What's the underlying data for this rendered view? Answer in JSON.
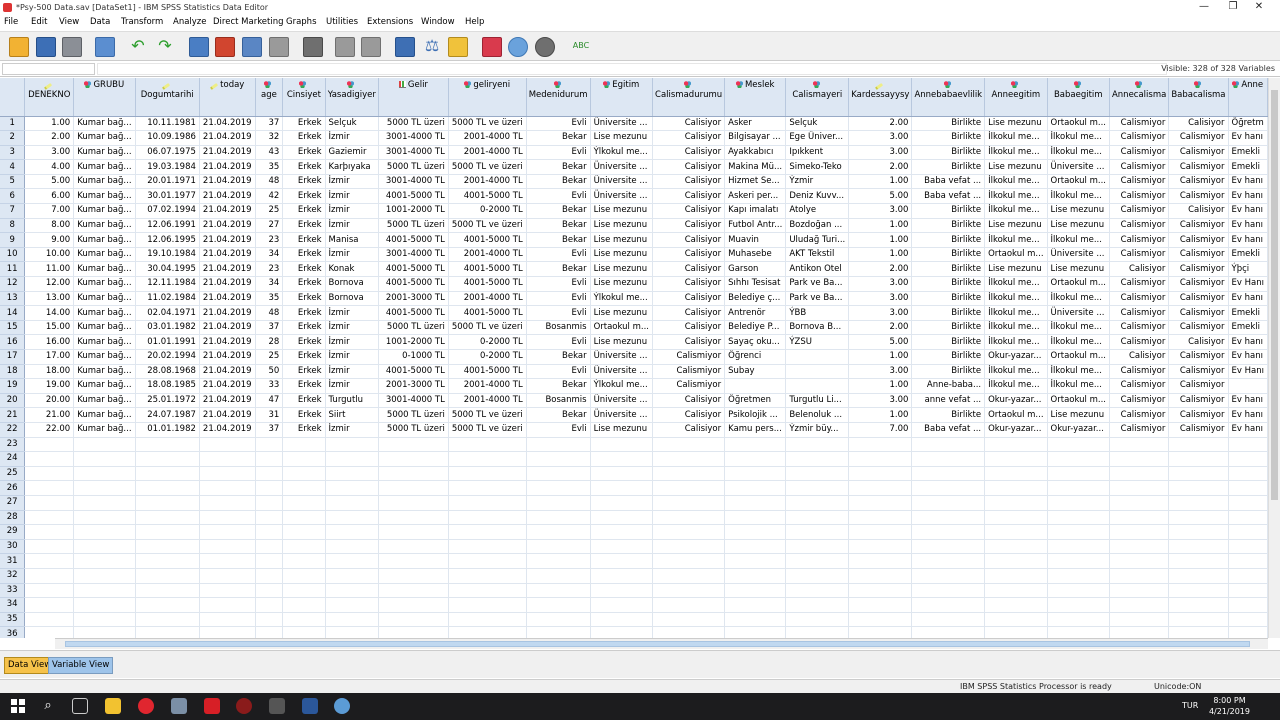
{
  "window": {
    "title": "*Psy-500 Data.sav [DataSet1] - IBM SPSS Statistics Data Editor",
    "minimize": "—",
    "restore": "❐",
    "close": "✕"
  },
  "menu": [
    "File",
    "Edit",
    "View",
    "Data",
    "Transform",
    "Analyze",
    "Direct Marketing",
    "Graphs",
    "Utilities",
    "Extensions",
    "Window",
    "Help"
  ],
  "toolbar_icons": [
    "open-folder-icon",
    "save-icon",
    "print-icon",
    "dialog-recall-icon",
    "undo-icon",
    "redo-icon",
    "goto-case-icon",
    "goto-variable-icon",
    "variables-icon",
    "find-icon",
    "insert-cases-icon",
    "insert-variable-icon",
    "split-file-icon",
    "weight-cases-icon",
    "select-cases-icon",
    "value-labels-icon",
    "use-sets-icon",
    "show-all-icon",
    "spelling-icon"
  ],
  "info": {
    "visible": "Visible: 328 of 328 Variables"
  },
  "grid": {
    "columns": [
      {
        "label": "DENEKNO",
        "type": "scale"
      },
      {
        "label": "GRUBU",
        "type": "nominal"
      },
      {
        "label": "Dogumtarihi",
        "type": "scale"
      },
      {
        "label": "today",
        "type": "scale"
      },
      {
        "label": "age",
        "type": "nominal"
      },
      {
        "label": "Cinsiyet",
        "type": "nominal"
      },
      {
        "label": "Yasadigiyer",
        "type": "nominal"
      },
      {
        "label": "Gelir",
        "type": "ordinal"
      },
      {
        "label": "geliryeni",
        "type": "nominal"
      },
      {
        "label": "Medenidurum",
        "type": "nominal"
      },
      {
        "label": "Egitim",
        "type": "nominal"
      },
      {
        "label": "Calismadurumu",
        "type": "nominal"
      },
      {
        "label": "Meslek",
        "type": "nominal"
      },
      {
        "label": "Calismayeri",
        "type": "nominal"
      },
      {
        "label": "Kardessayysy",
        "type": "scale"
      },
      {
        "label": "Annebabaevlilik",
        "type": "nominal"
      },
      {
        "label": "Anneegitim",
        "type": "nominal"
      },
      {
        "label": "Babaegitim",
        "type": "nominal"
      },
      {
        "label": "Annecalisma",
        "type": "nominal"
      },
      {
        "label": "Babacalisma",
        "type": "nominal"
      },
      {
        "label": "Anne",
        "type": "nominal"
      }
    ],
    "rows": [
      [
        "1.00",
        "Kumar bağ...",
        "10.11.1981",
        "21.04.2019",
        "37",
        "Erkek",
        "Selçuk",
        "5000 TL üzeri",
        "5000 TL ve üzeri",
        "Evli",
        "Üniversite ...",
        "Calisiyor",
        "Asker",
        "Selçuk",
        "2.00",
        "Birlikte",
        "Lise mezunu",
        "Ortaokul m...",
        "Calismiyor",
        "Calisiyor",
        "Öğretm"
      ],
      [
        "2.00",
        "Kumar bağ...",
        "10.09.1986",
        "21.04.2019",
        "32",
        "Erkek",
        "İzmir",
        "3001-4000 TL",
        "2001-4000 TL",
        "Bekar",
        "Lise mezunu",
        "Calisiyor",
        "Bilgisayar ...",
        "Ege Üniver...",
        "3.00",
        "Birlikte",
        "İlkokul me...",
        "İlkokul me...",
        "Calismiyor",
        "Calismiyor",
        "Ev hanı"
      ],
      [
        "3.00",
        "Kumar bağ...",
        "06.07.1975",
        "21.04.2019",
        "43",
        "Erkek",
        "Gaziemir",
        "3001-4000 TL",
        "2001-4000 TL",
        "Evli",
        "Ýlkokul me...",
        "Calisiyor",
        "Ayakkabıcı",
        "Ipıkkent",
        "3.00",
        "Birlikte",
        "İlkokul me...",
        "İlkokul me...",
        "Calismiyor",
        "Calismiyor",
        "Emekli"
      ],
      [
        "4.00",
        "Kumar bağ...",
        "19.03.1984",
        "21.04.2019",
        "35",
        "Erkek",
        "Karþıyaka",
        "5000 TL üzeri",
        "5000 TL ve üzeri",
        "Bekar",
        "Üniversite ...",
        "Calisiyor",
        "Makina Mü...",
        "Simeko-Teko",
        "2.00",
        "Birlikte",
        "Lise mezunu",
        "Üniversite ...",
        "Calismiyor",
        "Calismiyor",
        "Emekli"
      ],
      [
        "5.00",
        "Kumar bağ...",
        "20.01.1971",
        "21.04.2019",
        "48",
        "Erkek",
        "İzmir",
        "3001-4000 TL",
        "2001-4000 TL",
        "Bekar",
        "Üniversite ...",
        "Calisiyor",
        "Hizmet Se...",
        "Ýzmir",
        "1.00",
        "Baba vefat ...",
        "İlkokul me...",
        "Ortaokul m...",
        "Calismiyor",
        "Calismiyor",
        "Ev hanı"
      ],
      [
        "6.00",
        "Kumar bağ...",
        "30.01.1977",
        "21.04.2019",
        "42",
        "Erkek",
        "İzmir",
        "4001-5000 TL",
        "4001-5000 TL",
        "Evli",
        "Üniversite ...",
        "Calisiyor",
        "Askeri per...",
        "Deniz Kuvv...",
        "5.00",
        "Baba vefat ...",
        "İlkokul me...",
        "İlkokul me...",
        "Calismiyor",
        "Calismiyor",
        "Ev hanı"
      ],
      [
        "7.00",
        "Kumar bağ...",
        "07.02.1994",
        "21.04.2019",
        "25",
        "Erkek",
        "İzmir",
        "1001-2000 TL",
        "0-2000 TL",
        "Bekar",
        "Lise mezunu",
        "Calisiyor",
        "Kapı imalatı",
        "Atolye",
        "3.00",
        "Birlikte",
        "İlkokul me...",
        "Lise mezunu",
        "Calismiyor",
        "Calisiyor",
        "Ev hanı"
      ],
      [
        "8.00",
        "Kumar bağ...",
        "12.06.1991",
        "21.04.2019",
        "27",
        "Erkek",
        "İzmir",
        "5000 TL üzeri",
        "5000 TL ve üzeri",
        "Bekar",
        "Lise mezunu",
        "Calisiyor",
        "Futbol Antr...",
        "Bozdoğan ...",
        "1.00",
        "Birlikte",
        "Lise mezunu",
        "Lise mezunu",
        "Calismiyor",
        "Calismiyor",
        "Ev hanı"
      ],
      [
        "9.00",
        "Kumar bağ...",
        "12.06.1995",
        "21.04.2019",
        "23",
        "Erkek",
        "Manisa",
        "4001-5000 TL",
        "4001-5000 TL",
        "Bekar",
        "Lise mezunu",
        "Calisiyor",
        "Muavin",
        "Uludağ Turi...",
        "1.00",
        "Birlikte",
        "İlkokul me...",
        "İlkokul me...",
        "Calismiyor",
        "Calismiyor",
        "Ev hanı"
      ],
      [
        "10.00",
        "Kumar bağ...",
        "19.10.1984",
        "21.04.2019",
        "34",
        "Erkek",
        "İzmir",
        "3001-4000 TL",
        "2001-4000 TL",
        "Evli",
        "Lise mezunu",
        "Calisiyor",
        "Muhasebe",
        "AKT Tekstil",
        "1.00",
        "Birlikte",
        "Ortaokul m...",
        "Üniversite ...",
        "Calismiyor",
        "Calismiyor",
        "Emekli"
      ],
      [
        "11.00",
        "Kumar bağ...",
        "30.04.1995",
        "21.04.2019",
        "23",
        "Erkek",
        "Konak",
        "4001-5000 TL",
        "4001-5000 TL",
        "Bekar",
        "Lise mezunu",
        "Calisiyor",
        "Garson",
        "Antikon Otel",
        "2.00",
        "Birlikte",
        "Lise mezunu",
        "Lise mezunu",
        "Calisiyor",
        "Calismiyor",
        "Ýþçi"
      ],
      [
        "12.00",
        "Kumar bağ...",
        "12.11.1984",
        "21.04.2019",
        "34",
        "Erkek",
        "Bornova",
        "4001-5000 TL",
        "4001-5000 TL",
        "Evli",
        "Lise mezunu",
        "Calisiyor",
        "Sıhhı Tesisat",
        "Park ve Ba...",
        "3.00",
        "Birlikte",
        "İlkokul me...",
        "Ortaokul m...",
        "Calismiyor",
        "Calismiyor",
        "Ev Hanı"
      ],
      [
        "13.00",
        "Kumar bağ...",
        "11.02.1984",
        "21.04.2019",
        "35",
        "Erkek",
        "Bornova",
        "2001-3000 TL",
        "2001-4000 TL",
        "Evli",
        "Ýlkokul me...",
        "Calisiyor",
        "Belediye ç...",
        "Park ve Ba...",
        "3.00",
        "Birlikte",
        "İlkokul me...",
        "İlkokul me...",
        "Calismiyor",
        "Calismiyor",
        "Ev hanı"
      ],
      [
        "14.00",
        "Kumar bağ...",
        "02.04.1971",
        "21.04.2019",
        "48",
        "Erkek",
        "İzmir",
        "4001-5000 TL",
        "4001-5000 TL",
        "Evli",
        "Lise mezunu",
        "Calisiyor",
        "Antrenör",
        "ÝBB",
        "3.00",
        "Birlikte",
        "İlkokul me...",
        "Üniversite ...",
        "Calismiyor",
        "Calismiyor",
        "Emekli"
      ],
      [
        "15.00",
        "Kumar bağ...",
        "03.01.1982",
        "21.04.2019",
        "37",
        "Erkek",
        "İzmir",
        "5000 TL üzeri",
        "5000 TL ve üzeri",
        "Bosanmis",
        "Ortaokul m...",
        "Calisiyor",
        "Belediye P...",
        "Bornova B...",
        "2.00",
        "Birlikte",
        "İlkokul me...",
        "İlkokul me...",
        "Calismiyor",
        "Calismiyor",
        "Emekli"
      ],
      [
        "16.00",
        "Kumar bağ...",
        "01.01.1991",
        "21.04.2019",
        "28",
        "Erkek",
        "İzmir",
        "1001-2000 TL",
        "0-2000 TL",
        "Evli",
        "Lise mezunu",
        "Calisiyor",
        "Sayaç oku...",
        "ÝZSU",
        "5.00",
        "Birlikte",
        "İlkokul me...",
        "İlkokul me...",
        "Calismiyor",
        "Calisiyor",
        "Ev hanı"
      ],
      [
        "17.00",
        "Kumar bağ...",
        "20.02.1994",
        "21.04.2019",
        "25",
        "Erkek",
        "İzmir",
        "0-1000 TL",
        "0-2000 TL",
        "Bekar",
        "Üniversite ...",
        "Calismiyor",
        "Öğrenci",
        "",
        "1.00",
        "Birlikte",
        "Okur-yazar...",
        "Ortaokul m...",
        "Calisiyor",
        "Calismiyor",
        "Ev hanı"
      ],
      [
        "18.00",
        "Kumar bağ...",
        "28.08.1968",
        "21.04.2019",
        "50",
        "Erkek",
        "İzmir",
        "4001-5000 TL",
        "4001-5000 TL",
        "Evli",
        "Üniversite ...",
        "Calismiyor",
        "Subay",
        "",
        "3.00",
        "Birlikte",
        "İlkokul me...",
        "İlkokul me...",
        "Calismiyor",
        "Calismiyor",
        "Ev Hanı"
      ],
      [
        "19.00",
        "Kumar bağ...",
        "18.08.1985",
        "21.04.2019",
        "33",
        "Erkek",
        "İzmir",
        "2001-3000 TL",
        "2001-4000 TL",
        "Bekar",
        "Ýlkokul me...",
        "Calismiyor",
        "",
        "",
        "1.00",
        "Anne-baba...",
        "İlkokul me...",
        "İlkokul me...",
        "Calismiyor",
        "Calismiyor",
        ""
      ],
      [
        "20.00",
        "Kumar bağ...",
        "25.01.1972",
        "21.04.2019",
        "47",
        "Erkek",
        "Turgutlu",
        "3001-4000 TL",
        "2001-4000 TL",
        "Bosanmis",
        "Üniversite ...",
        "Calisiyor",
        "Öğretmen",
        "Turgutlu Li...",
        "3.00",
        "anne vefat ...",
        "Okur-yazar...",
        "Ortaokul m...",
        "Calismiyor",
        "Calismiyor",
        "Ev hanı"
      ],
      [
        "21.00",
        "Kumar bağ...",
        "24.07.1987",
        "21.04.2019",
        "31",
        "Erkek",
        "Siirt",
        "5000 TL üzeri",
        "5000 TL ve üzeri",
        "Bekar",
        "Üniversite ...",
        "Calisiyor",
        "Psikolojik ...",
        "Belenoluk ...",
        "1.00",
        "Birlikte",
        "Ortaokul m...",
        "Lise mezunu",
        "Calismiyor",
        "Calismiyor",
        "Ev hanı"
      ],
      [
        "22.00",
        "Kumar bağ...",
        "01.01.1982",
        "21.04.2019",
        "37",
        "Erkek",
        "İzmir",
        "5000 TL üzeri",
        "5000 TL ve üzeri",
        "Evli",
        "Lise mezunu",
        "Calisiyor",
        "Kamu pers...",
        "Ýzmir büy...",
        "7.00",
        "Baba vefat ...",
        "Okur-yazar...",
        "Okur-yazar...",
        "Calismiyor",
        "Calismiyor",
        "Ev hanı"
      ]
    ],
    "empty_row_numbers": [
      "23",
      "24",
      "25",
      "26",
      "27",
      "28",
      "29",
      "30",
      "31",
      "32",
      "33",
      "34",
      "35",
      "36"
    ]
  },
  "tabs": {
    "data_view": "Data View",
    "variable_view": "Variable View"
  },
  "status": {
    "processor": "IBM SPSS Statistics Processor is ready",
    "unicode": "Unicode:ON"
  },
  "taskbar": {
    "lang": "TUR",
    "time": "8:00 PM",
    "date": "4/21/2019"
  }
}
